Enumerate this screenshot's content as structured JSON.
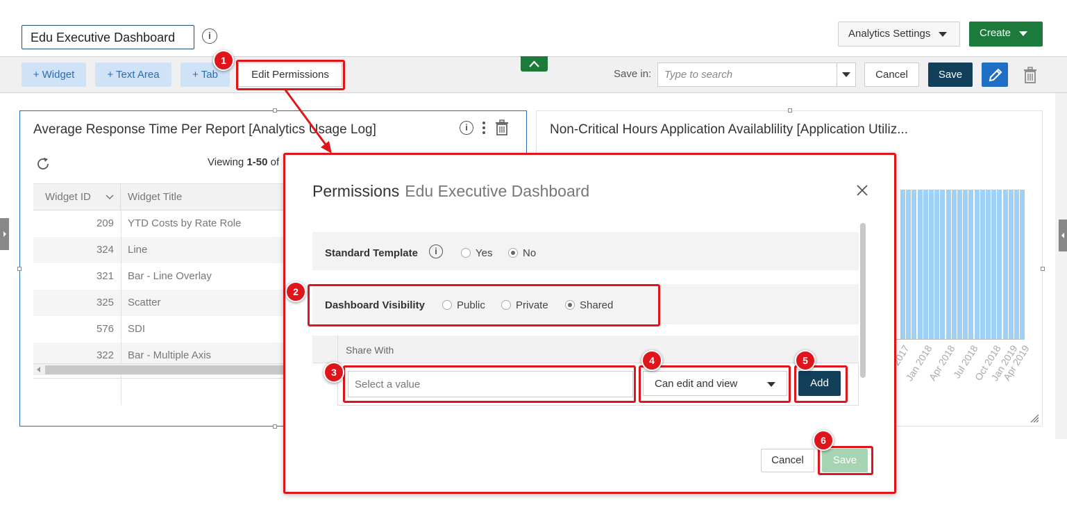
{
  "header": {
    "dashboard_title": "Edu Executive Dashboard",
    "analytics_settings_label": "Analytics Settings",
    "create_label": "Create"
  },
  "toolbar": {
    "add_widget": "+ Widget",
    "add_text_area": "+ Text Area",
    "add_tab": "+ Tab",
    "edit_permissions": "Edit Permissions",
    "save_in_label": "Save in:",
    "search_placeholder": "Type to search",
    "cancel_label": "Cancel",
    "save_label": "Save"
  },
  "widget1": {
    "title": "Average Response Time Per Report [Analytics Usage Log]",
    "viewing_prefix": "Viewing ",
    "viewing_range": "1-50",
    "viewing_suffix": " of",
    "columns": [
      "Widget ID",
      "Widget Title"
    ],
    "rows": [
      {
        "id": "209",
        "title": "YTD Costs by Rate Role"
      },
      {
        "id": "324",
        "title": "Line"
      },
      {
        "id": "321",
        "title": "Bar - Line Overlay"
      },
      {
        "id": "325",
        "title": "Scatter"
      },
      {
        "id": "576",
        "title": "SDI"
      },
      {
        "id": "322",
        "title": "Bar - Multiple Axis"
      }
    ]
  },
  "widget2": {
    "title": "Non-Critical Hours Application Availablility [Application Utiliz..."
  },
  "chart_data": {
    "type": "bar",
    "categories": [
      "2017",
      "Jan 2018",
      "Apr 2018",
      "Jul 2018",
      "Oct 2018",
      "Jan 2019",
      "Apr 2019"
    ],
    "values": [
      99,
      99,
      99,
      99,
      99,
      99,
      99,
      99,
      99,
      99,
      99,
      99,
      99,
      99,
      99,
      99,
      99,
      99,
      99,
      99,
      99,
      99
    ],
    "ylim": [
      0,
      100
    ],
    "bar_color": "#9fd0f5"
  },
  "modal": {
    "title": "Permissions",
    "subtitle": "Edu Executive Dashboard",
    "standard_template_label": "Standard Template",
    "std_options": [
      {
        "label": "Yes",
        "checked": false
      },
      {
        "label": "No",
        "checked": true
      }
    ],
    "visibility_label": "Dashboard Visibility",
    "vis_options": [
      {
        "label": "Public",
        "checked": false
      },
      {
        "label": "Private",
        "checked": false
      },
      {
        "label": "Shared",
        "checked": true
      }
    ],
    "share_with_header": "Share With",
    "select_placeholder": "Select a value",
    "permission_value": "Can edit and view",
    "add_label": "Add",
    "cancel_label": "Cancel",
    "save_label": "Save"
  },
  "annotations": [
    "1",
    "2",
    "3",
    "4",
    "5",
    "6"
  ],
  "colors": {
    "accent_green": "#1c7a3b",
    "navy": "#123f5a",
    "highlight_red": "#e0141b",
    "light_blue": "#cfe2f6"
  }
}
